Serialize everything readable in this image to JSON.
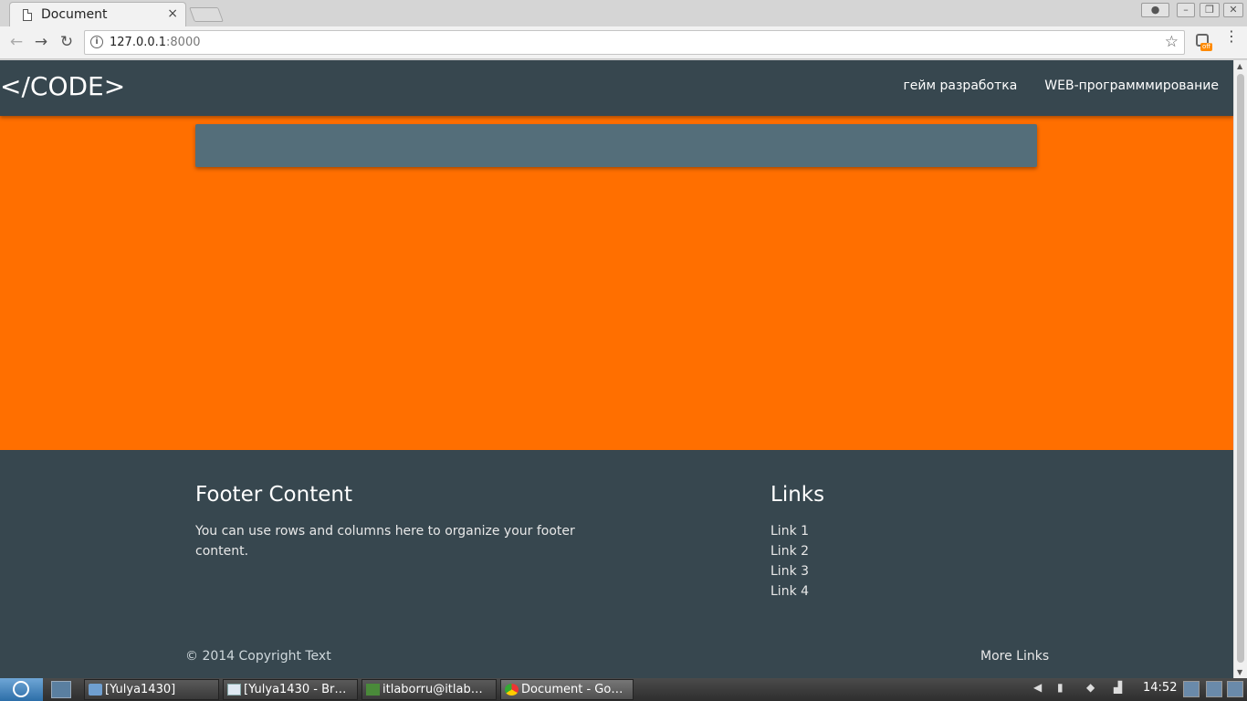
{
  "browser": {
    "tab_title": "Document",
    "tab_close": "×",
    "url_host": "127.0.0.1",
    "url_port": ":8000",
    "ext_badge": "off"
  },
  "site": {
    "brand": "</CODE>",
    "nav_links": [
      "гейм разработка",
      "WEB-программмирование"
    ]
  },
  "footer": {
    "left_title": "Footer Content",
    "left_text": "You can use rows and columns here to organize your footer content.",
    "right_title": "Links",
    "links": [
      "Link 1",
      "Link 2",
      "Link 3",
      "Link 4"
    ],
    "copyright": "© 2014 Copyright Text",
    "more_links": "More Links"
  },
  "taskbar": {
    "tasks": [
      "[Yulya1430]",
      "[Yulya1430 - Br…",
      "itlaborru@itlab…",
      "Document - Go…"
    ],
    "clock": "14:52"
  },
  "colors": {
    "nav_bg": "#37474f",
    "page_bg": "#ff6f00",
    "card_bg": "#546e7a"
  },
  "icons": [
    "page-icon",
    "close-icon",
    "new-tab-icon",
    "back-icon",
    "forward-icon",
    "reload-icon",
    "info-icon",
    "star-icon",
    "extension-icon",
    "menu-icon"
  ]
}
